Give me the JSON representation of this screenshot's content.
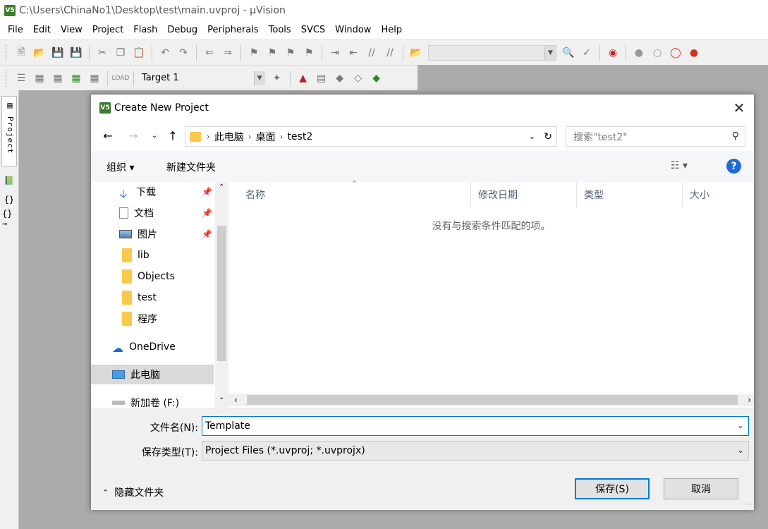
{
  "app": {
    "title": "C:\\Users\\ChinaNo1\\Desktop\\test\\main.uvproj - µVision",
    "icon_text": "V5",
    "menu": [
      "File",
      "Edit",
      "View",
      "Project",
      "Flash",
      "Debug",
      "Peripherals",
      "Tools",
      "SVCS",
      "Window",
      "Help"
    ],
    "target": "Target 1",
    "left_panel": {
      "project_tab": "Project",
      "icons": [
        "books-icon",
        "braces-icon",
        "function-icon"
      ]
    }
  },
  "dialog": {
    "title": "Create New Project",
    "breadcrumb": [
      "此电脑",
      "桌面",
      "test2"
    ],
    "search_placeholder": "搜索\"test2\"",
    "organize": "组织 ▾",
    "new_folder": "新建文件夹",
    "help": "?",
    "nav_items": [
      {
        "label": "下载",
        "icon": "download-icon",
        "pinned": true
      },
      {
        "label": "文档",
        "icon": "document-icon",
        "pinned": true
      },
      {
        "label": "图片",
        "icon": "picture-icon",
        "pinned": true
      },
      {
        "label": "lib",
        "icon": "folder-icon",
        "pinned": false
      },
      {
        "label": "Objects",
        "icon": "folder-icon",
        "pinned": false
      },
      {
        "label": "test",
        "icon": "folder-icon",
        "pinned": false
      },
      {
        "label": "程序",
        "icon": "folder-icon",
        "pinned": false
      },
      {
        "label": "OneDrive",
        "icon": "cloud-icon",
        "pinned": false
      },
      {
        "label": "此电脑",
        "icon": "computer-icon",
        "pinned": false,
        "selected": true
      },
      {
        "label": "新加卷 (F:)",
        "icon": "drive-icon",
        "pinned": false
      }
    ],
    "columns": [
      "名称",
      "修改日期",
      "类型",
      "大小"
    ],
    "empty_message": "没有与搜索条件匹配的项。",
    "filename_label": "文件名(N):",
    "filename_value": "Template",
    "filetype_label": "保存类型(T):",
    "filetype_value": "Project Files (*.uvproj; *.uvprojx)",
    "hide_folders": "隐藏文件夹",
    "save_button": "保存(S)",
    "cancel_button": "取消",
    "colors": {
      "accent": "#0078d7",
      "folder": "#f8c94b",
      "help": "#1e6ad6"
    }
  }
}
